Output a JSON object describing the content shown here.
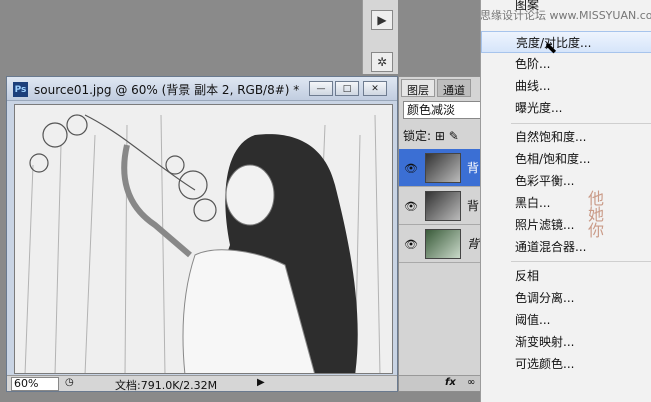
{
  "watermark": "思缘设计论坛 www.MISSYUAN.com",
  "document": {
    "title": "source01.jpg @ 60% (背景 副本 2, RGB/8#) *",
    "zoom": "60%",
    "doc_info": "文档:791.0K/2.32M"
  },
  "layers_panel": {
    "tabs": [
      "图层",
      "通道"
    ],
    "blend_mode": "颜色减淡",
    "lock_label": "锁定:",
    "layers": [
      {
        "name": "背"
      },
      {
        "name": "背"
      },
      {
        "name": "背"
      }
    ],
    "fx_label": "fx"
  },
  "menu": {
    "items": [
      {
        "label": "图案"
      },
      {
        "label": "亮度/对比度...",
        "highlighted": true
      },
      {
        "label": "色阶..."
      },
      {
        "label": "曲线..."
      },
      {
        "label": "曝光度..."
      },
      {
        "label": "自然饱和度..."
      },
      {
        "label": "色相/饱和度..."
      },
      {
        "label": "色彩平衡..."
      },
      {
        "label": "黑白..."
      },
      {
        "label": "照片滤镜..."
      },
      {
        "label": "通道混合器..."
      },
      {
        "label": "反相"
      },
      {
        "label": "色调分离..."
      },
      {
        "label": "阈值..."
      },
      {
        "label": "渐变映射..."
      },
      {
        "label": "可选颜色..."
      }
    ]
  },
  "colors": {
    "menu_highlight": "#d6e5fa",
    "layer_selected": "#3b6fd4"
  }
}
